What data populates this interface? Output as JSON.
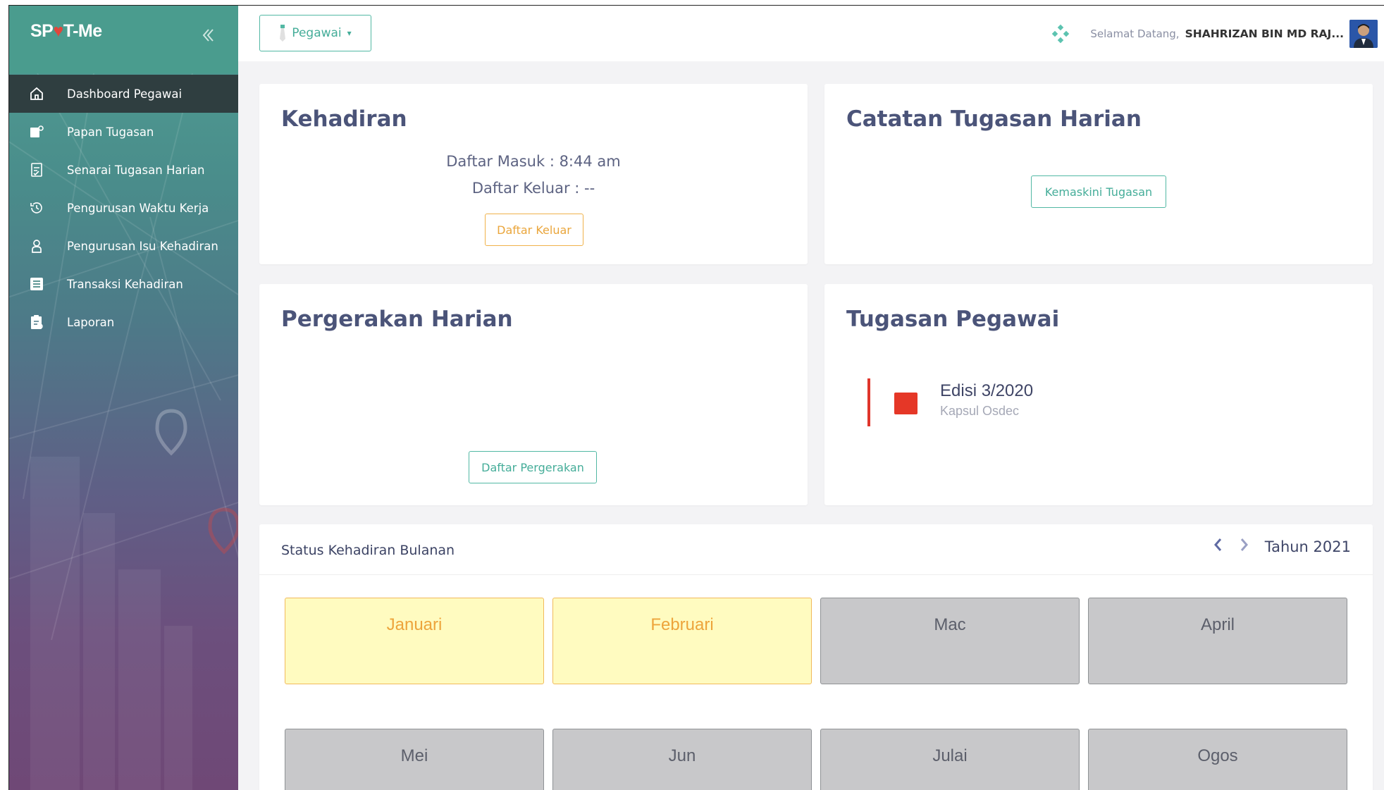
{
  "app": {
    "logo_prefix": "SP",
    "logo_pin": "♥",
    "logo_suffix": "T-Me"
  },
  "sidebar": {
    "collapse_icon": "double-chevron-left-icon",
    "items": [
      {
        "label": "Dashboard Pegawai",
        "icon": "home-icon",
        "active": true
      },
      {
        "label": "Papan Tugasan",
        "icon": "board-icon"
      },
      {
        "label": "Senarai Tugasan Harian",
        "icon": "task-list-icon"
      },
      {
        "label": "Pengurusan Waktu Kerja",
        "icon": "history-icon"
      },
      {
        "label": "Pengurusan Isu Kehadiran",
        "icon": "user-icon"
      },
      {
        "label": "Transaksi Kehadiran",
        "icon": "list-icon"
      },
      {
        "label": "Laporan",
        "icon": "report-icon"
      }
    ]
  },
  "topbar": {
    "role_label": "Pegawai",
    "welcome": "Selamat Datang,",
    "username": "SHAHRIZAN BIN MD RAJ..."
  },
  "kehadiran": {
    "title": "Kehadiran",
    "check_in": "Daftar Masuk : 8:44 am",
    "check_out": "Daftar Keluar : --",
    "button": "Daftar Keluar"
  },
  "catatan": {
    "title": "Catatan Tugasan Harian",
    "button": "Kemaskini Tugasan"
  },
  "pergerakan": {
    "title": "Pergerakan Harian",
    "button": "Daftar Pergerakan"
  },
  "tugasan": {
    "title": "Tugasan Pegawai",
    "item_title": "Edisi 3/2020",
    "item_sub": "Kapsul Osdec",
    "accent": "#e53727"
  },
  "status": {
    "title": "Status Kehadiran Bulanan",
    "year": "Tahun 2021",
    "months": [
      {
        "name": "Januari",
        "state": "yellow"
      },
      {
        "name": "Februari",
        "state": "yellow"
      },
      {
        "name": "Mac",
        "state": "grey"
      },
      {
        "name": "April",
        "state": "grey"
      },
      {
        "name": "Mei",
        "state": "grey"
      },
      {
        "name": "Jun",
        "state": "grey"
      },
      {
        "name": "Julai",
        "state": "grey"
      },
      {
        "name": "Ogos",
        "state": "grey"
      }
    ]
  },
  "colors": {
    "accent": "#52b8a4",
    "orange": "#f0b24a",
    "sidebar_active": "#2f3e40"
  }
}
